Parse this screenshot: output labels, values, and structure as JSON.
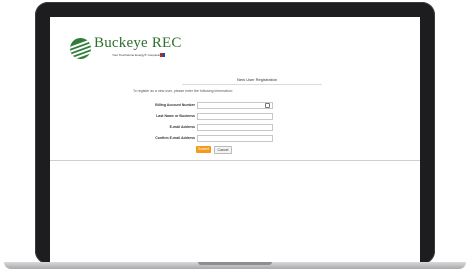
{
  "brand": {
    "name": "Buckeye REC",
    "tagline": "Your Touchstone Energy® Cooperative",
    "primary_color": "#2e6e30",
    "accent_color": "#f39a1e"
  },
  "form": {
    "title": "New User Registration",
    "intro": "To register as a new user, please enter the following information:",
    "fields": [
      {
        "label": "Billing Account Number",
        "value": "",
        "icon": "info-icon"
      },
      {
        "label": "Last Name or Business",
        "value": ""
      },
      {
        "label": "E-mail Address",
        "value": ""
      },
      {
        "label": "Confirm E-mail Address",
        "value": ""
      }
    ],
    "submit_label": "Submit",
    "cancel_label": "Cancel"
  }
}
